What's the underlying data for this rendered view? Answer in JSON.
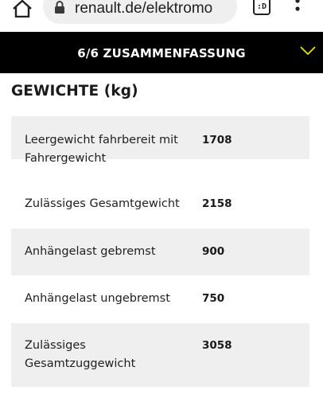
{
  "browser": {
    "url": "renault.de/elektromo",
    "tab_count": ":D"
  },
  "step_header": {
    "title": "6/6 ZUSAMMENFASSUNG",
    "accent_color": "#efdf00"
  },
  "section": {
    "title": "GEWICHTE (kg)"
  },
  "weights": [
    {
      "label": "Leergewicht fahrbereit mit Fahrergewicht",
      "value": "1708"
    },
    {
      "label": "Zulässiges Gesamtgewicht",
      "value": "2158"
    },
    {
      "label": "Anhängelast gebremst",
      "value": "900"
    },
    {
      "label": "Anhängelast ungebremst",
      "value": "750"
    },
    {
      "label": "Zulässiges Gesamtzuggewicht",
      "value": "3058"
    }
  ]
}
